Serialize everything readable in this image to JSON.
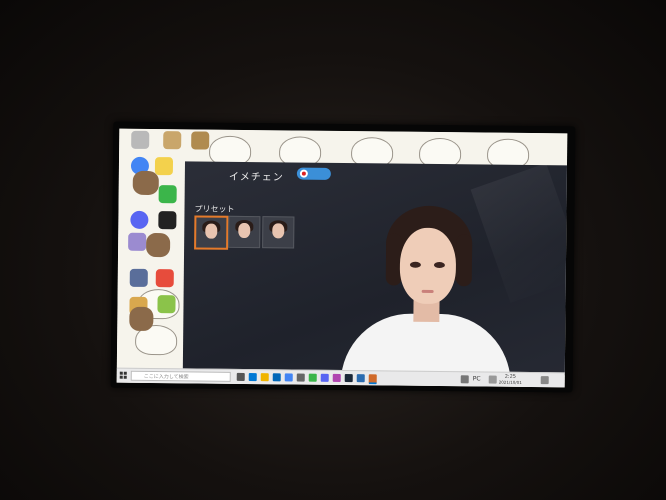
{
  "app": {
    "title": "イメチェン",
    "preset_label": "プリセット"
  },
  "taskbar": {
    "search_placeholder": "ここに入力して検索",
    "lang": "PC",
    "time": "2:25",
    "date": "2021/10/01"
  },
  "colors": {
    "app_bg": "#242730",
    "selected_border": "#e57a2a",
    "taskbar_bg": "#e9e9ea",
    "wallpaper_bg": "#f6f4ec"
  }
}
